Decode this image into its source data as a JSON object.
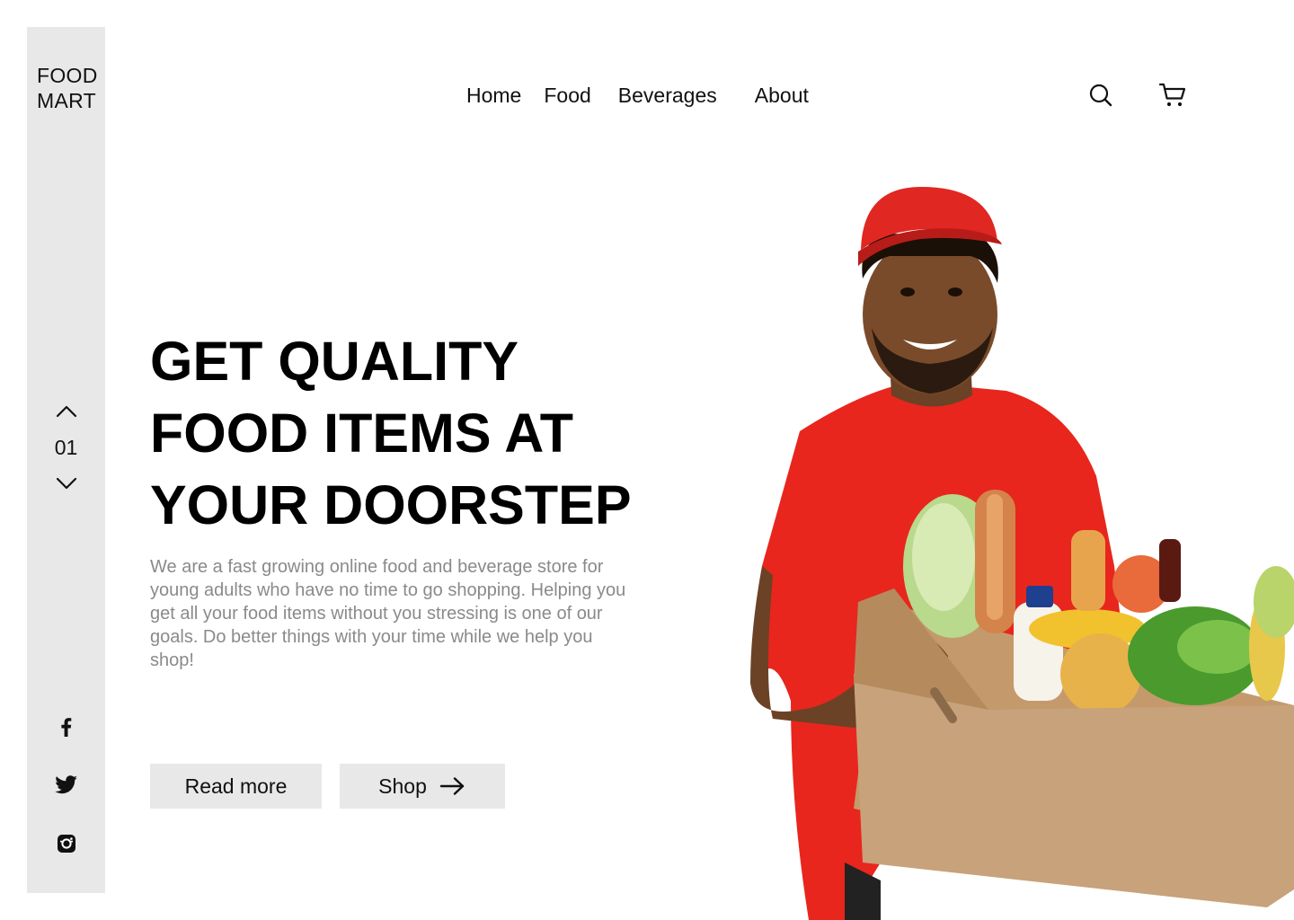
{
  "brand": {
    "line1": "FOOD",
    "line2": "MART"
  },
  "nav": {
    "home": "Home",
    "food": "Food",
    "beverages": "Beverages",
    "about": "About"
  },
  "header_icons": {
    "search": "search-icon",
    "cart": "cart-icon"
  },
  "slider": {
    "current": "01",
    "up_icon": "chevron-up-icon",
    "down_icon": "chevron-down-icon"
  },
  "socials": [
    "facebook-icon",
    "twitter-icon",
    "instagram-icon"
  ],
  "hero": {
    "title_line1": "GET QUALITY",
    "title_line2": "FOOD ITEMS AT",
    "title_line3": "YOUR DOORSTEP",
    "description": "We are a fast growing online food and beverage store for young adults who have no time to go shopping. Helping you get all your food items without you stressing is one of our goals. Do better things with your time while we help you shop!"
  },
  "buttons": {
    "read_more": "Read more",
    "shop": "Shop"
  },
  "colors": {
    "sidebar_bg": "#e8e8e8",
    "button_bg": "#e8e8e8",
    "description_text": "#8a8a8a",
    "accent_red": "#e8261d"
  }
}
